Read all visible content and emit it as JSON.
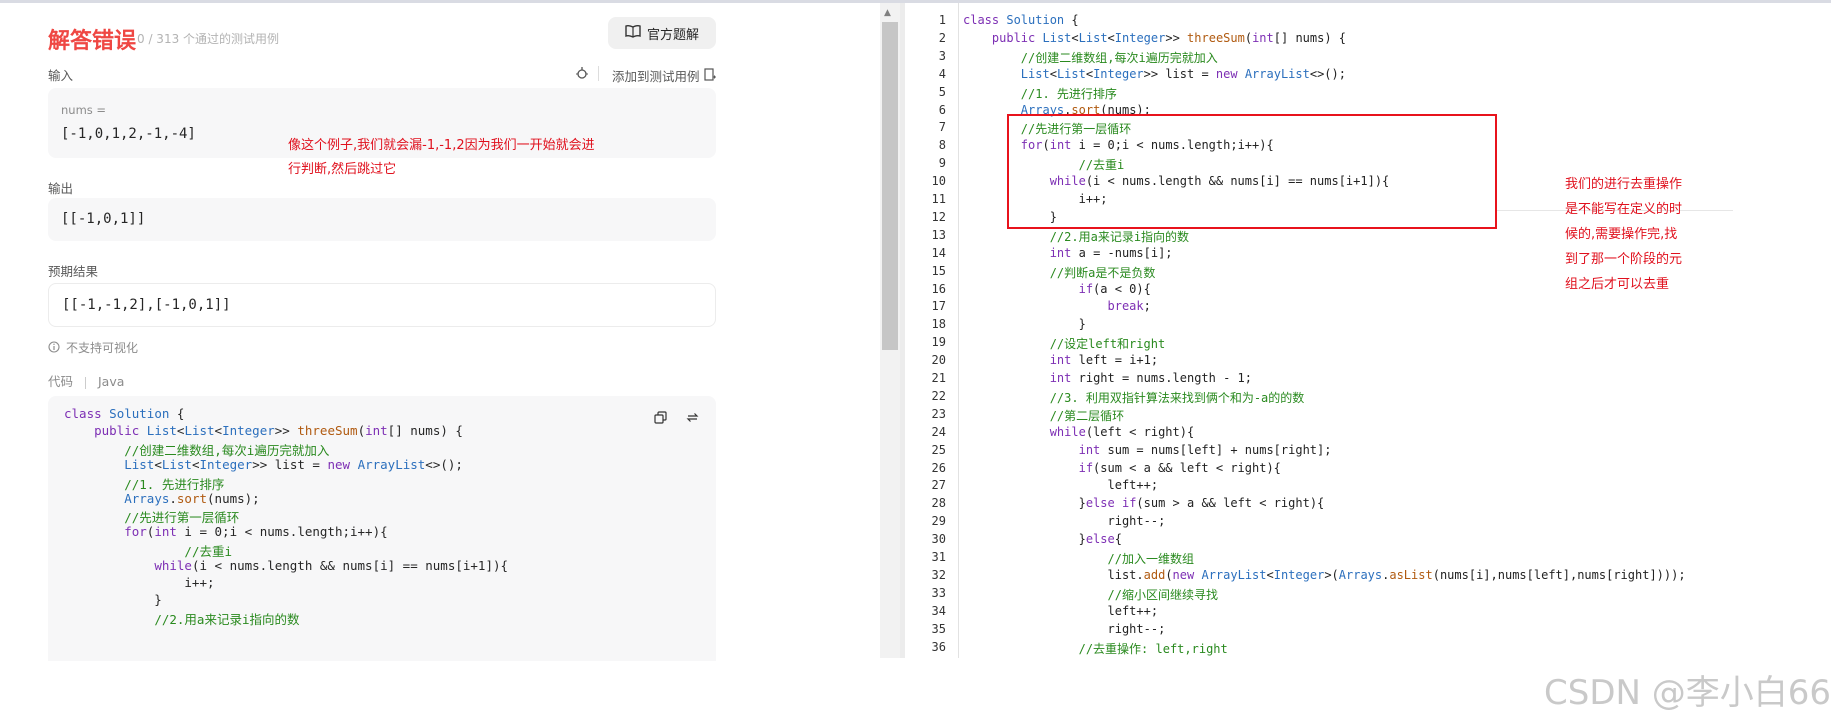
{
  "result": {
    "title": "解答错误",
    "subtitle": "0 / 313 个通过的测试用例",
    "official_solution_label": "官方题解"
  },
  "input": {
    "label": "输入",
    "add_testcase_label": "添加到测试用例",
    "var_name": "nums =",
    "value": "[-1,0,1,2,-1,-4]"
  },
  "output": {
    "label": "输出",
    "value": "[[-1,0,1]]"
  },
  "expected": {
    "label": "预期结果",
    "value": "[[-1,-1,2],[-1,0,1]]"
  },
  "visualize_note": "不支持可视化",
  "code_meta": {
    "label": "代码",
    "language": "Java"
  },
  "annotation_left": [
    "像这个例子,我们就会漏-1,-1,2因为我们一开始就会进",
    "行判断,然后跳过它"
  ],
  "annotation_right": [
    "我们的进行去重操作",
    "是不能写在定义的时",
    "候的,需要操作完,找",
    "到了那一个阶段的元",
    "组之后才可以去重"
  ],
  "watermark": "CSDN @李小白66",
  "left_code": [
    "class Solution {",
    "    public List<List<Integer>> threeSum(int[] nums) {",
    "        //创建二维数组,每次i遍历完就加入",
    "        List<List<Integer>> list = new ArrayList<>();",
    "        //1. 先进行排序",
    "        Arrays.sort(nums);",
    "        //先进行第一层循环",
    "        for(int i = 0;i < nums.length;i++){",
    "                //去重i",
    "            while(i < nums.length && nums[i] == nums[i+1]){",
    "                i++;",
    "            }",
    "            //2.用a来记录i指向的数"
  ],
  "editor_lines": [
    "class Solution {",
    "    public List<List<Integer>> threeSum(int[] nums) {",
    "        //创建二维数组,每次i遍历完就加入",
    "        List<List<Integer>> list = new ArrayList<>();",
    "        //1. 先进行排序",
    "        Arrays.sort(nums);",
    "        //先进行第一层循环",
    "        for(int i = 0;i < nums.length;i++){",
    "                //去重i",
    "            while(i < nums.length && nums[i] == nums[i+1]){",
    "                i++;",
    "            }",
    "            //2.用a来记录i指向的数",
    "            int a = -nums[i];",
    "            //判断a是不是负数",
    "                if(a < 0){",
    "                    break;",
    "                }",
    "            //设定left和right",
    "            int left = i+1;",
    "            int right = nums.length - 1;",
    "            //3. 利用双指针算法来找到俩个和为-a的的数",
    "            //第二层循环",
    "            while(left < right){",
    "                int sum = nums[left] + nums[right];",
    "                if(sum < a && left < right){",
    "                    left++;",
    "                }else if(sum > a && left < right){",
    "                    right--;",
    "                }else{",
    "                    //加入一维数组",
    "                    list.add(new ArrayList<Integer>(Arrays.asList(nums[i],nums[left],nums[right])));",
    "                    //缩小区间继续寻找",
    "                    left++;",
    "                    right--;",
    "                //去重操作: left,right"
  ],
  "colors": {
    "error_red": "#ef4743",
    "annotation_red": "#e0101d",
    "keyword_purple": "#7d2fb4",
    "type_blue": "#2b6fbd",
    "comment_green": "#2a8a1f"
  }
}
